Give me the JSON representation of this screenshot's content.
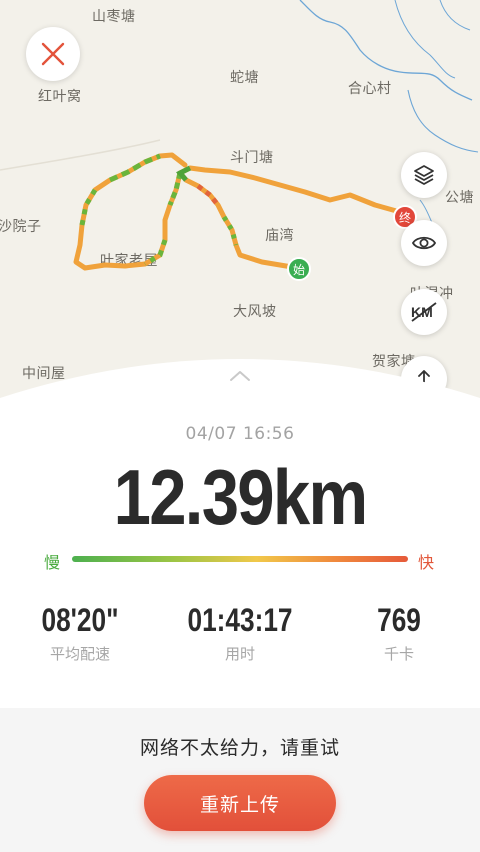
{
  "map": {
    "places": [
      {
        "name": "山枣塘"
      },
      {
        "name": "红叶窝"
      },
      {
        "name": "蛇塘"
      },
      {
        "name": "合心村"
      },
      {
        "name": "斗门塘"
      },
      {
        "name": "公塘"
      },
      {
        "name": "沙院子"
      },
      {
        "name": "庙湾"
      },
      {
        "name": "叶家老屋"
      },
      {
        "name": "叶湿冲"
      },
      {
        "name": "大风坡"
      },
      {
        "name": "中间屋"
      },
      {
        "name": "贺家塘"
      }
    ],
    "start_marker": "始",
    "end_marker": "终",
    "buttons": {
      "close_icon": "close-icon",
      "layers_icon": "layers-icon",
      "eye_icon": "eye-icon",
      "km_icon": "km-icon",
      "share_icon": "share-icon"
    }
  },
  "run": {
    "date": "04/07 16:56",
    "distance": "12.39km",
    "slow_label": "慢",
    "fast_label": "快",
    "stats": [
      {
        "value": "08'20\"",
        "label": "平均配速"
      },
      {
        "value": "01:43:17",
        "label": "用时"
      },
      {
        "value": "769",
        "label": "千卡"
      }
    ]
  },
  "footer": {
    "message": "网络不太给力，请重试",
    "retry_label": "重新上传"
  },
  "colors": {
    "accent": "#e65a3a",
    "slow": "#4aab3f",
    "fast": "#e2573a",
    "route_orange": "#f0a23b",
    "route_green": "#6ab53c"
  }
}
